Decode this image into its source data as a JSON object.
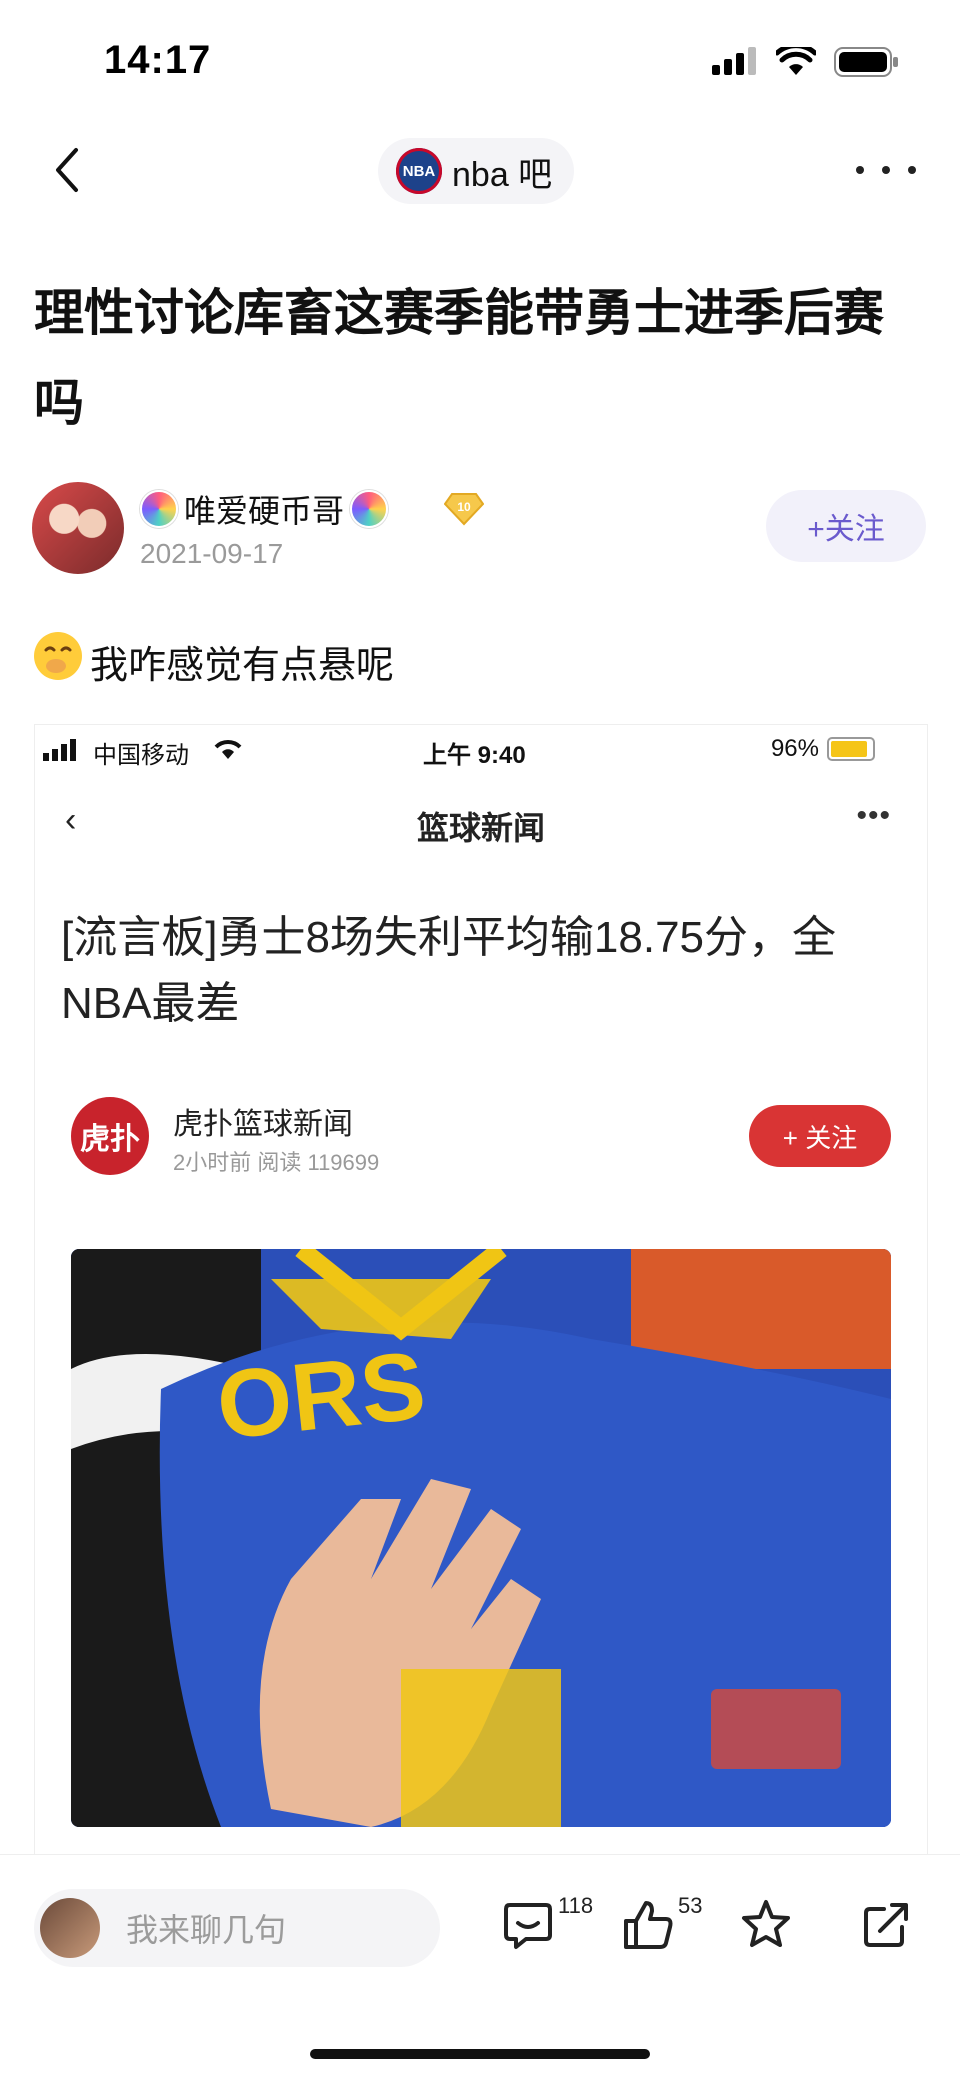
{
  "status_bar": {
    "time": "14:17"
  },
  "nav": {
    "forum_name": "nba 吧",
    "forum_logo_text": "NBA"
  },
  "post": {
    "title": "理性讨论库畜这赛季能带勇士进季后赛吗",
    "author": {
      "name": "唯爱硬币哥",
      "level": "10",
      "date": "2021-09-17"
    },
    "follow_label": "+关注",
    "body_text": "我咋感觉有点悬呢"
  },
  "embedded_screenshot": {
    "carrier": "中国移动",
    "time": "上午 9:40",
    "battery": "96%",
    "nav_title": "篮球新闻",
    "headline": "[流言板]勇士8场失利平均输18.75分，全NBA最差",
    "source_logo": "虎扑",
    "source_name": "虎扑篮球新闻",
    "source_meta": "2小时前   阅读 119699",
    "follow_label": "+ 关注",
    "photo_text": "ORS"
  },
  "bottom_bar": {
    "reply_placeholder": "我来聊几句",
    "comments": "118",
    "likes": "53"
  },
  "colors": {
    "accent": "#6a5acd",
    "hupu_red": "#d93434",
    "warriors_blue": "#2b4fb8",
    "warriors_gold": "#f0c514"
  }
}
